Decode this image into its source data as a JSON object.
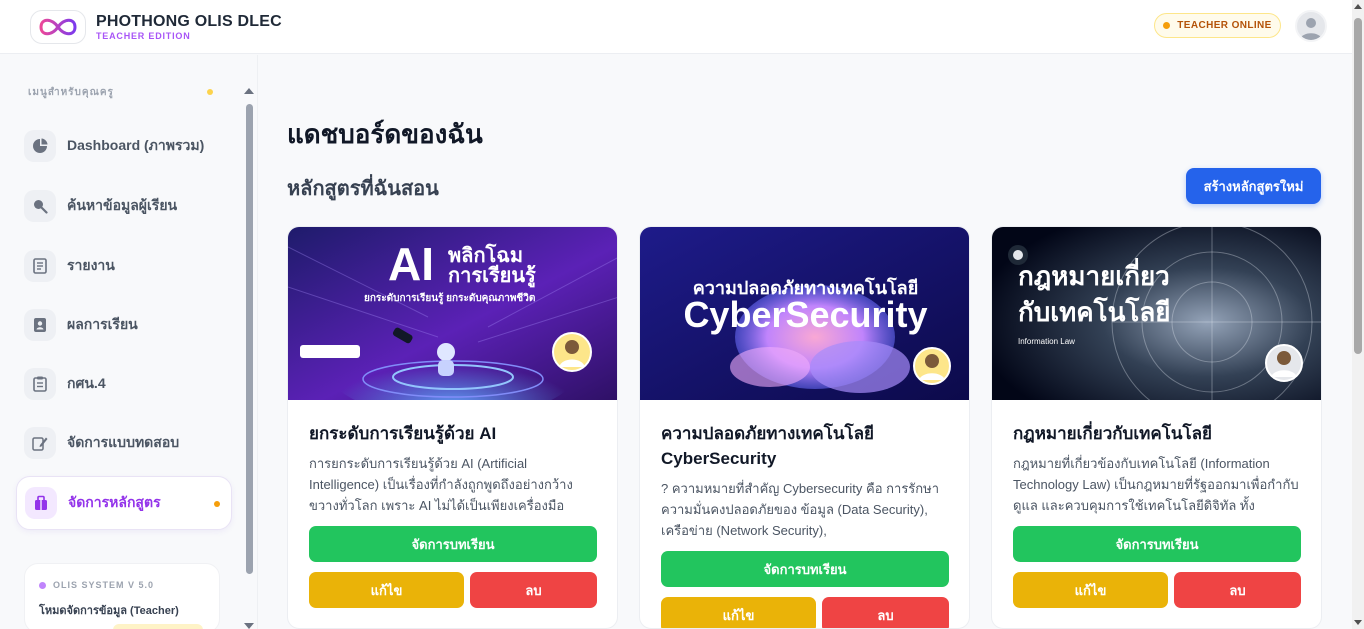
{
  "header": {
    "brand_title": "PHOTHONG OLIS DLEC",
    "brand_subtitle": "TEACHER EDITION",
    "status": "TEACHER ONLINE"
  },
  "sidebar": {
    "heading": "เมนูสำหรับคุณครู",
    "items": [
      {
        "label": "Dashboard (ภาพรวม)",
        "icon": "pie-chart-icon"
      },
      {
        "label": "ค้นหาข้อมูลผู้เรียน",
        "icon": "search-icon"
      },
      {
        "label": "รายงาน",
        "icon": "report-icon"
      },
      {
        "label": "ผลการเรียน",
        "icon": "id-card-icon"
      },
      {
        "label": "กศน.4",
        "icon": "clipboard-icon"
      },
      {
        "label": "จัดการแบบทดสอบ",
        "icon": "quiz-edit-icon"
      },
      {
        "label": "จัดการหลักสูตร",
        "icon": "course-icon",
        "active": true
      }
    ],
    "system_label": "OLIS SYSTEM V 5.0",
    "system_mode": "โหมดจัดการข้อมูล (Teacher)"
  },
  "main": {
    "page_title": "แดชบอร์ดของฉัน",
    "section_title": "หลักสูตรที่ฉันสอน",
    "create_button": "สร้างหลักสูตรใหม่",
    "courses": [
      {
        "title": "ยกระดับการเรียนรู้ด้วย AI",
        "description": "การยกระดับการเรียนรู้ด้วย AI (Artificial Intelligence) เป็นเรื่องที่กำลังถูกพูดถึงอย่างกว้างขวางทั่วโลก เพราะ AI ไม่ได้เป็นเพียงเครื่องมือ",
        "image_text": {
          "big": "AI",
          "line1": "พลิกโฉม",
          "line2": "การเรียนรู้",
          "tagline": "ยกระดับการเรียนรู้ ยกระดับคุณภาพชีวิต"
        },
        "manage_label": "จัดการบทเรียน",
        "edit_label": "แก้ไข",
        "delete_label": "ลบ"
      },
      {
        "title": "ความปลอดภัยทางเทคโนโลยี CyberSecurity",
        "description": "? ความหมายที่สำคัญ Cybersecurity คือ การรักษาความมั่นคงปลอดภัยของ ข้อมูล (Data Security), เครือข่าย (Network Security),",
        "image_text": {
          "line1": "ความปลอดภัยทางเทคโนโลยี",
          "line2": "CyberSecurity"
        },
        "manage_label": "จัดการบทเรียน",
        "edit_label": "แก้ไข",
        "delete_label": "ลบ"
      },
      {
        "title": "กฎหมายเกี่ยวกับเทคโนโลยี",
        "description": "กฎหมายที่เกี่ยวข้องกับเทคโนโลยี (Information Technology Law) เป็นกฎหมายที่รัฐออกมาเพื่อกำกับ ดูแล และควบคุมการใช้เทคโนโลยีดิจิทัล ทั้ง",
        "image_text": {
          "line1": "กฎหมายเกี่ยว",
          "line2": "กับเทคโนโลยี",
          "small": "Information Law"
        },
        "manage_label": "จัดการบทเรียน",
        "edit_label": "แก้ไข",
        "delete_label": "ลบ"
      }
    ]
  }
}
